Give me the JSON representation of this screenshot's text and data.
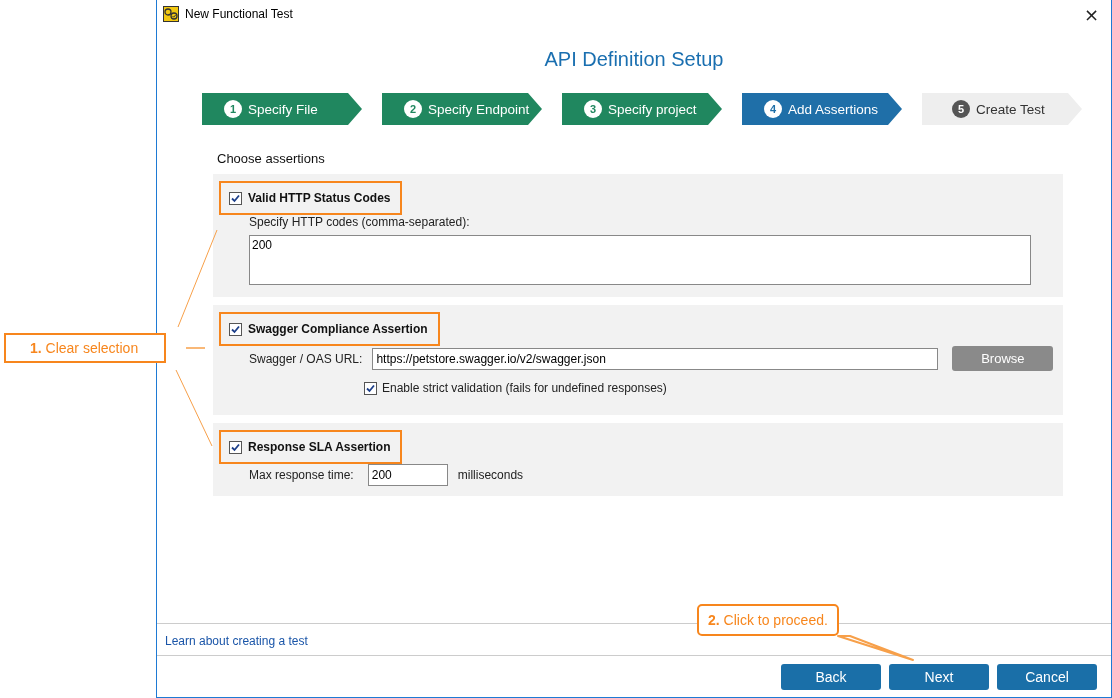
{
  "window": {
    "title": "New Functional Test",
    "close": "×"
  },
  "heading": "API Definition Setup",
  "steps": [
    {
      "number": "1",
      "label": "Specify File",
      "completed": true,
      "selected": false
    },
    {
      "number": "2",
      "label": "Specify Endpoint",
      "completed": true,
      "selected": false
    },
    {
      "number": "3",
      "label": "Specify project",
      "completed": true,
      "selected": false
    },
    {
      "number": "4",
      "label": "Add Assertions",
      "completed": false,
      "selected": true
    },
    {
      "number": "5",
      "label": "Create Test",
      "completed": false,
      "selected": false
    }
  ],
  "section_label": "Choose assertions",
  "assertions": [
    {
      "kind": "codes",
      "label": "Valid HTTP Status Codes",
      "checked": true,
      "highlighted": true,
      "field_label": "Specify HTTP codes (comma-separated):",
      "value": "200"
    },
    {
      "kind": "url",
      "label": "Swagger Compliance Assertion",
      "checked": true,
      "highlighted": true,
      "field_label": "Swagger / OAS URL:",
      "value": "https://petstore.swagger.io/v2/swagger.json",
      "button": "Browse",
      "option": {
        "label": "Enable strict validation (fails for undefined responses)",
        "checked": true
      }
    },
    {
      "kind": "time",
      "label": "Response SLA Assertion",
      "checked": true,
      "highlighted": true,
      "field_label": "Max response time:",
      "value": "200",
      "unit": "milliseconds"
    }
  ],
  "footer": {
    "link": "Learn about creating a test",
    "buttons": [
      "Back",
      "Next",
      "Cancel"
    ]
  },
  "callouts": [
    {
      "text": "**1.** Clear selection"
    },
    {
      "text": "**2.** Click to proceed."
    }
  ]
}
